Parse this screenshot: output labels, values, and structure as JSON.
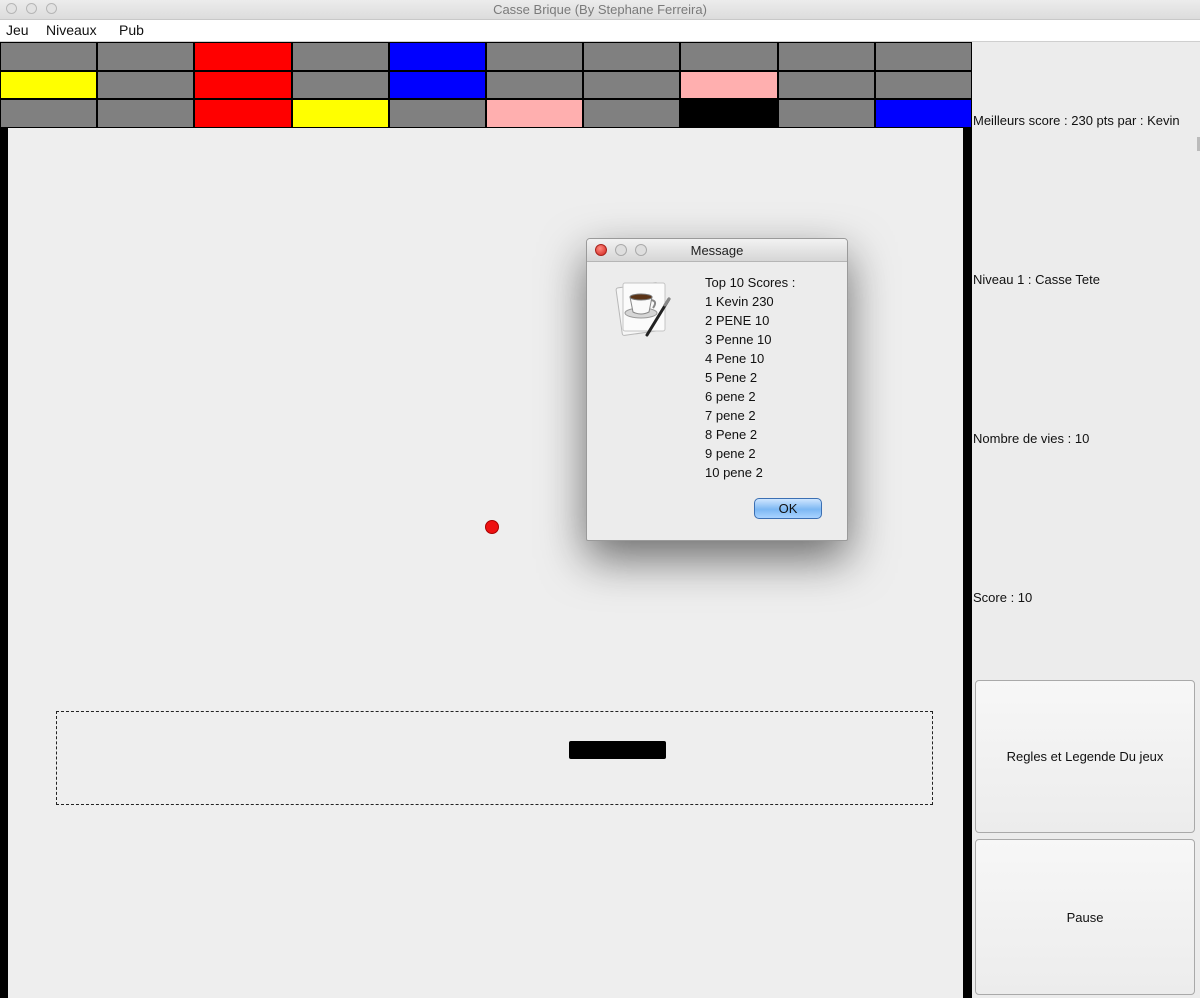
{
  "window": {
    "title": "Casse Brique (By Stephane Ferreira)"
  },
  "menu": {
    "items": [
      "Jeu",
      "Niveaux",
      "Pub"
    ]
  },
  "bricks": {
    "rows": [
      [
        "#808080",
        "#808080",
        "#ff0000",
        "#808080",
        "#0000ff",
        "#808080",
        "#808080",
        "#808080",
        "#808080",
        "#808080"
      ],
      [
        "#ffff00",
        "#808080",
        "#ff0000",
        "#808080",
        "#0000ff",
        "#808080",
        "#808080",
        "#ffafaf",
        "#808080",
        "#808080"
      ],
      [
        "#808080",
        "#808080",
        "#ff0000",
        "#ffff00",
        "#808080",
        "#ffafaf",
        "#808080",
        "#000000",
        "#808080",
        "#0000ff"
      ]
    ]
  },
  "sidebar": {
    "best_score": "Meilleurs score : 230 pts par : Kevin",
    "level": "Niveau 1 : Casse Tete",
    "lives": "Nombre de vies : 10",
    "score": "Score : 10",
    "rules_button": "Regles et Legende Du jeux",
    "pause_button": "Pause"
  },
  "dialog": {
    "title": "Message",
    "heading": "Top 10 Scores :",
    "scores": [
      "1 Kevin 230",
      "2 PENE 10",
      "3 Penne 10",
      "4 Pene 10",
      "5 Pene 2",
      "6 pene 2",
      "7 pene 2",
      "8 Pene 2",
      "9 pene 2",
      "10 pene 2"
    ],
    "ok_label": "OK",
    "icon": "java-coffee-cup-icon"
  }
}
